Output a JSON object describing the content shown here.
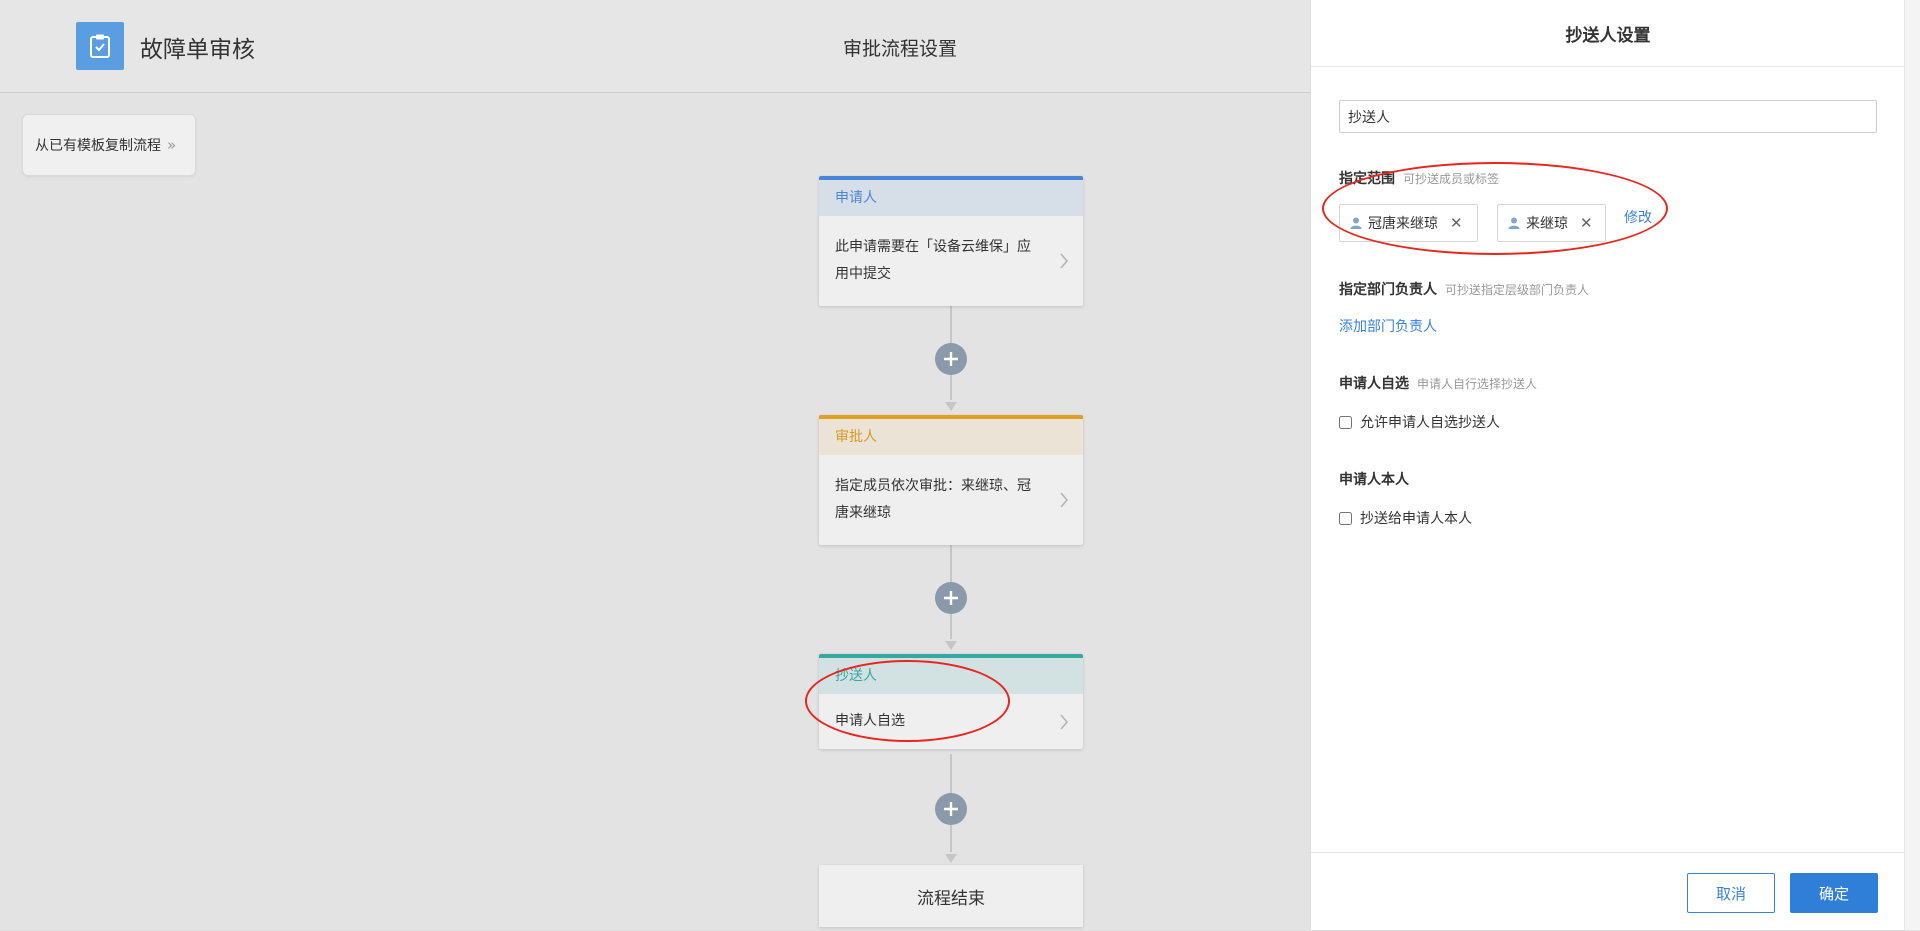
{
  "header": {
    "app_title": "故障单审核",
    "center_title": "审批流程设置"
  },
  "toolbar": {
    "copy_template_label": "从已有模板复制流程"
  },
  "flow": {
    "applicant": {
      "title": "申请人",
      "desc": "此申请需要在「设备云维保」应用中提交"
    },
    "approver": {
      "title": "审批人",
      "desc": "指定成员依次审批：来继琼、冠唐来继琼"
    },
    "cc": {
      "title": "抄送人",
      "desc": "申请人自选"
    },
    "end_label": "流程结束"
  },
  "panel": {
    "title": "抄送人设置",
    "name_input_value": "抄送人",
    "scope": {
      "title": "指定范围",
      "hint": "可抄送成员或标签",
      "tags": [
        "冠唐来继琼",
        "来继琼"
      ],
      "modify_label": "修改"
    },
    "dept": {
      "title": "指定部门负责人",
      "hint": "可抄送指定层级部门负责人",
      "add_label": "添加部门负责人"
    },
    "self_select": {
      "title": "申请人自选",
      "hint": "申请人自行选择抄送人",
      "checkbox_label": "允许申请人自选抄送人"
    },
    "applicant_self": {
      "title": "申请人本人",
      "checkbox_label": "抄送给申请人本人"
    },
    "cancel_label": "取消",
    "confirm_label": "确定"
  },
  "colors": {
    "accent": "#3a82d8",
    "applicant": "#4a86d8",
    "approver": "#e0a020",
    "cc": "#35a8a4",
    "annotation": "#e8261e"
  }
}
